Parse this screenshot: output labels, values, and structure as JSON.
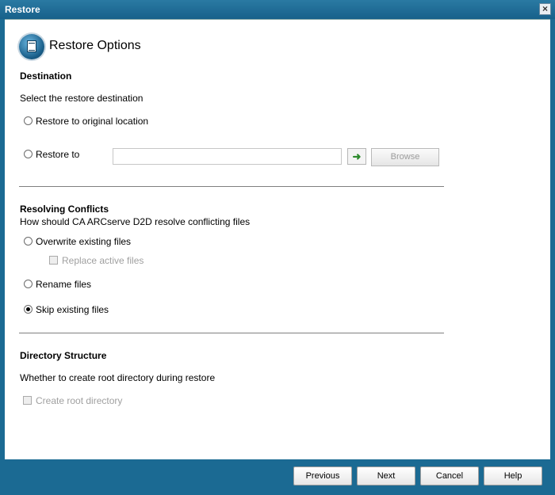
{
  "window": {
    "title": "Restore",
    "close_glyph": "×"
  },
  "header": {
    "title": "Restore Options",
    "icon": "restore-options-icon"
  },
  "destination": {
    "title": "Destination",
    "subtitle": "Select the restore destination",
    "options": [
      {
        "label": "Restore to original location",
        "selected": false
      },
      {
        "label": "Restore to",
        "selected": false
      }
    ],
    "path_value": "",
    "go_glyph": "➜",
    "browse_label": "Browse"
  },
  "conflicts": {
    "title": "Resolving Conflicts",
    "subtitle": "How should CA ARCserve D2D  resolve conflicting files",
    "options": [
      {
        "label": "Overwrite existing files",
        "selected": false
      },
      {
        "label": "Rename files",
        "selected": false
      },
      {
        "label": "Skip existing files",
        "selected": true
      }
    ],
    "replace_active_label": "Replace active files",
    "replace_active_checked": false,
    "replace_active_enabled": false
  },
  "directory": {
    "title": "Directory Structure",
    "subtitle": "Whether to create root directory during restore",
    "create_root_label": "Create root directory",
    "create_root_checked": false,
    "create_root_enabled": false
  },
  "footer": {
    "previous_label": "Previous",
    "next_label": "Next",
    "cancel_label": "Cancel",
    "help_label": "Help"
  },
  "colors": {
    "frame": "#1b6a93",
    "content_bg": "#ffffff",
    "disabled_text": "#a0a0a0"
  }
}
